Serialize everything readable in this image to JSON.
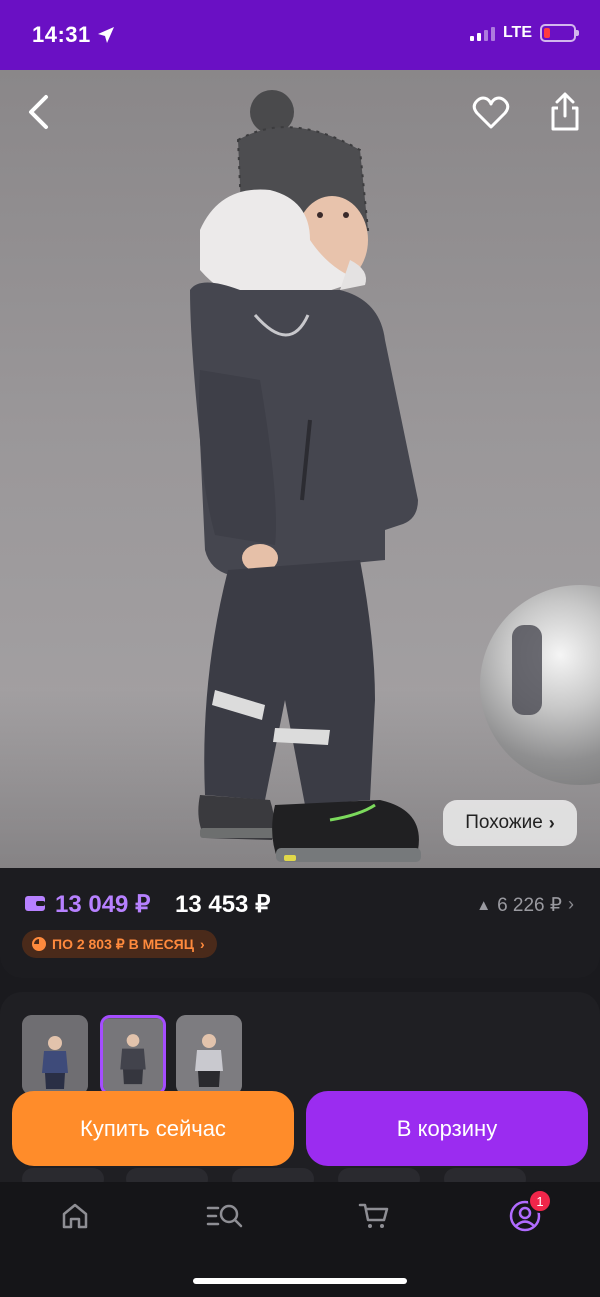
{
  "status": {
    "time": "14:31",
    "network": "LTE",
    "icons": [
      "location-arrow-icon",
      "signal-icon",
      "battery-icon"
    ],
    "battery_color": "#ff3b40"
  },
  "header": {
    "icons": [
      "chevron-left-icon",
      "heart-icon",
      "share-icon"
    ]
  },
  "gallery": {
    "similar_label": "Похожие",
    "similar_chevron": "›"
  },
  "price": {
    "main": "13 049 ₽",
    "alt": "13 453 ₽",
    "old": "6 226 ₽",
    "old_arrow": "▲",
    "chevron": "›",
    "installment": "ПО 2 803 ₽ В МЕСЯЦ",
    "installment_chevron": "›",
    "accent_color": "#b781ff",
    "installment_color": "#ff8a3d"
  },
  "thumbnails": {
    "count": 3,
    "selected_index": 1
  },
  "actions": {
    "buy_label": "Купить сейчас",
    "cart_label": "В корзину",
    "buy_color": "#ff8c2a",
    "cart_color": "#9b2cf0"
  },
  "tabbar": {
    "icons": [
      "home-icon",
      "catalog-search-icon",
      "cart-icon",
      "profile-icon"
    ],
    "profile_badge": "1"
  }
}
